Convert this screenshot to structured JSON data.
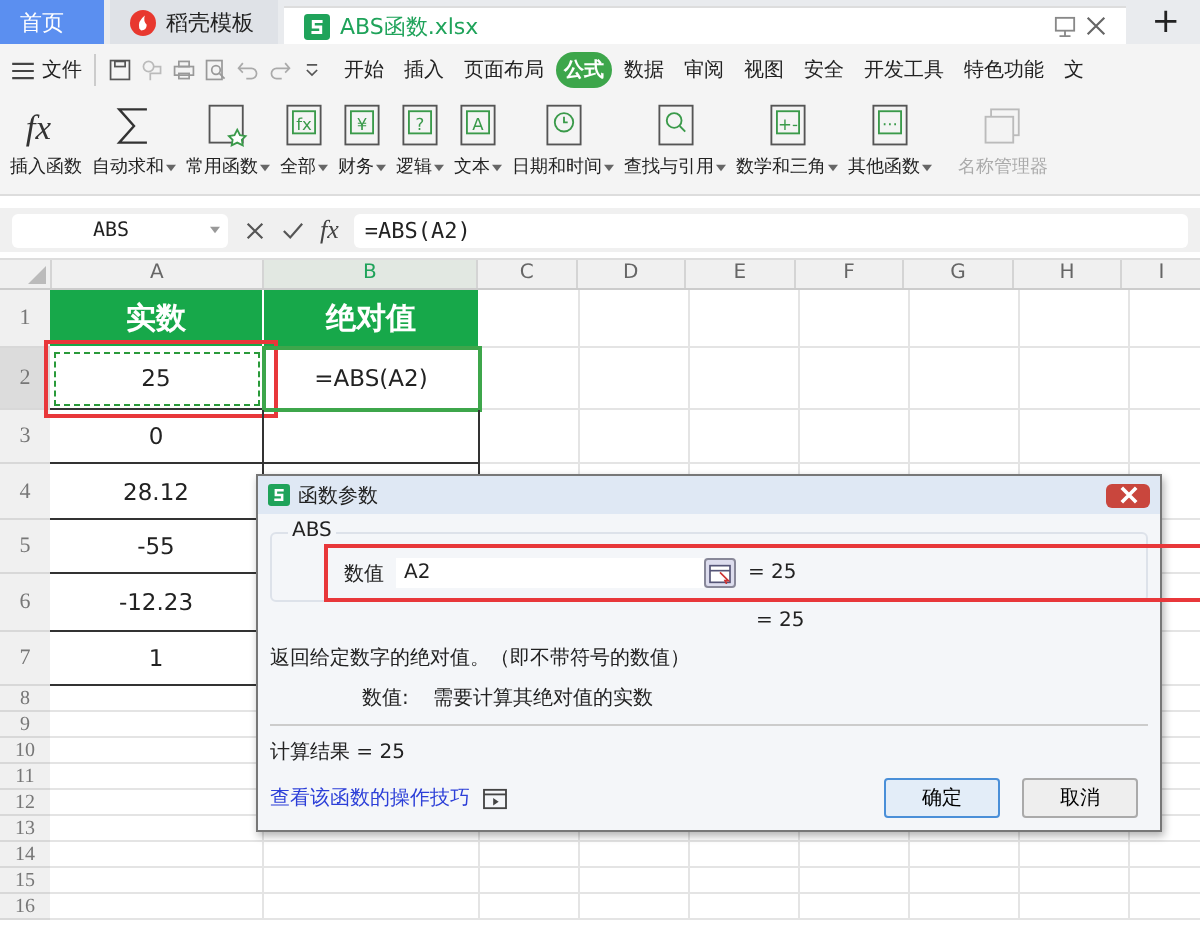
{
  "tabs": [
    {
      "label": "首页",
      "kind": "home",
      "selected": false
    },
    {
      "label": "稻壳模板",
      "kind": "docer",
      "selected": false
    },
    {
      "label": "ABS函数.xlsx",
      "kind": "sheet",
      "selected": true
    }
  ],
  "new_tab": "+",
  "menu": {
    "file": "文件",
    "tabs": [
      {
        "label": "开始",
        "selected": false
      },
      {
        "label": "插入",
        "selected": false
      },
      {
        "label": "页面布局",
        "selected": false
      },
      {
        "label": "公式",
        "selected": true
      },
      {
        "label": "数据",
        "selected": false
      },
      {
        "label": "审阅",
        "selected": false
      },
      {
        "label": "视图",
        "selected": false
      },
      {
        "label": "安全",
        "selected": false
      },
      {
        "label": "开发工具",
        "selected": false
      },
      {
        "label": "特色功能",
        "selected": false
      },
      {
        "label": "文",
        "selected": false
      }
    ]
  },
  "ribbon": [
    {
      "label": "插入函数",
      "kind": "fx",
      "glyph": "fx",
      "dropdown": false,
      "disabled": false
    },
    {
      "label": "自动求和",
      "kind": "sum",
      "dropdown": true,
      "disabled": false
    },
    {
      "label": "常用函数",
      "kind": "star",
      "dropdown": true,
      "disabled": false
    },
    {
      "label": "全部",
      "kind": "fxbook",
      "glyph": "fx",
      "dropdown": true,
      "disabled": false
    },
    {
      "label": "财务",
      "kind": "book",
      "glyph": "¥",
      "dropdown": true,
      "disabled": false
    },
    {
      "label": "逻辑",
      "kind": "book",
      "glyph": "?",
      "dropdown": true,
      "disabled": false
    },
    {
      "label": "文本",
      "kind": "book",
      "glyph": "A",
      "dropdown": true,
      "disabled": false
    },
    {
      "label": "日期和时间",
      "kind": "clock",
      "dropdown": true,
      "disabled": false
    },
    {
      "label": "查找与引用",
      "kind": "search",
      "dropdown": true,
      "disabled": false
    },
    {
      "label": "数学和三角",
      "kind": "book",
      "glyph": "+-",
      "dropdown": true,
      "disabled": false
    },
    {
      "label": "其他函数",
      "kind": "book",
      "glyph": "···",
      "dropdown": true,
      "disabled": false
    },
    {
      "label": "名称管理器",
      "kind": "names",
      "dropdown": false,
      "disabled": true
    }
  ],
  "formula_bar": {
    "name_box": "ABS",
    "fx": "fx",
    "formula": "=ABS(A2)"
  },
  "sheet": {
    "columns": [
      {
        "label": "A",
        "selected": false
      },
      {
        "label": "B",
        "selected": true
      },
      {
        "label": "C",
        "selected": false
      },
      {
        "label": "D",
        "selected": false
      },
      {
        "label": "E",
        "selected": false
      },
      {
        "label": "F",
        "selected": false
      },
      {
        "label": "G",
        "selected": false
      },
      {
        "label": "H",
        "selected": false
      },
      {
        "label": "I",
        "selected": false
      }
    ],
    "rows": [
      {
        "header": "1",
        "selected": false,
        "cells": [
          {
            "text": "实数",
            "kind": "header"
          },
          {
            "text": "绝对值",
            "kind": "header"
          }
        ]
      },
      {
        "header": "2",
        "selected": true,
        "cells": [
          {
            "text": "25",
            "kind": "data",
            "marquee": true,
            "highlighted": true
          },
          {
            "text": "=ABS(A2)",
            "kind": "data",
            "active": true
          }
        ]
      },
      {
        "header": "3",
        "selected": false,
        "cells": [
          {
            "text": "0",
            "kind": "data"
          },
          {
            "kind": "data"
          }
        ]
      },
      {
        "header": "4",
        "selected": false,
        "cells": [
          {
            "text": "28.12",
            "kind": "data"
          },
          {
            "kind": "data"
          }
        ]
      },
      {
        "header": "5",
        "selected": false,
        "cells": [
          {
            "text": "-55",
            "kind": "data"
          },
          {
            "kind": "data"
          }
        ]
      },
      {
        "header": "6",
        "selected": false,
        "cells": [
          {
            "text": "-12.23",
            "kind": "data"
          },
          {
            "kind": "data"
          }
        ]
      },
      {
        "header": "7",
        "selected": false,
        "cells": [
          {
            "text": "1",
            "kind": "data"
          },
          {
            "kind": "data"
          }
        ]
      },
      {
        "header": "8",
        "selected": false,
        "cells": []
      },
      {
        "header": "9",
        "selected": false,
        "cells": []
      },
      {
        "header": "10",
        "selected": false,
        "cells": []
      },
      {
        "header": "11",
        "selected": false,
        "cells": []
      },
      {
        "header": "12",
        "selected": false,
        "cells": []
      },
      {
        "header": "13",
        "selected": false,
        "cells": []
      },
      {
        "header": "14",
        "selected": false,
        "cells": []
      },
      {
        "header": "15",
        "selected": false,
        "cells": []
      },
      {
        "header": "16",
        "selected": false,
        "cells": []
      }
    ]
  },
  "dialog": {
    "title": "函数参数",
    "function_name": "ABS",
    "argument": {
      "label": "数值",
      "value": "A2",
      "result": "= 25",
      "highlighted": true
    },
    "result": "= 25",
    "description": "返回给定数字的绝对值。（即不带符号的数值）",
    "arg_help_label": "数值:",
    "arg_help": "需要计算其绝对值的实数",
    "calc_result": "计算结果 = 25",
    "link": "查看该函数的操作技巧",
    "buttons": [
      {
        "label": "确定",
        "primary": true
      },
      {
        "label": "取消",
        "primary": false
      }
    ]
  }
}
